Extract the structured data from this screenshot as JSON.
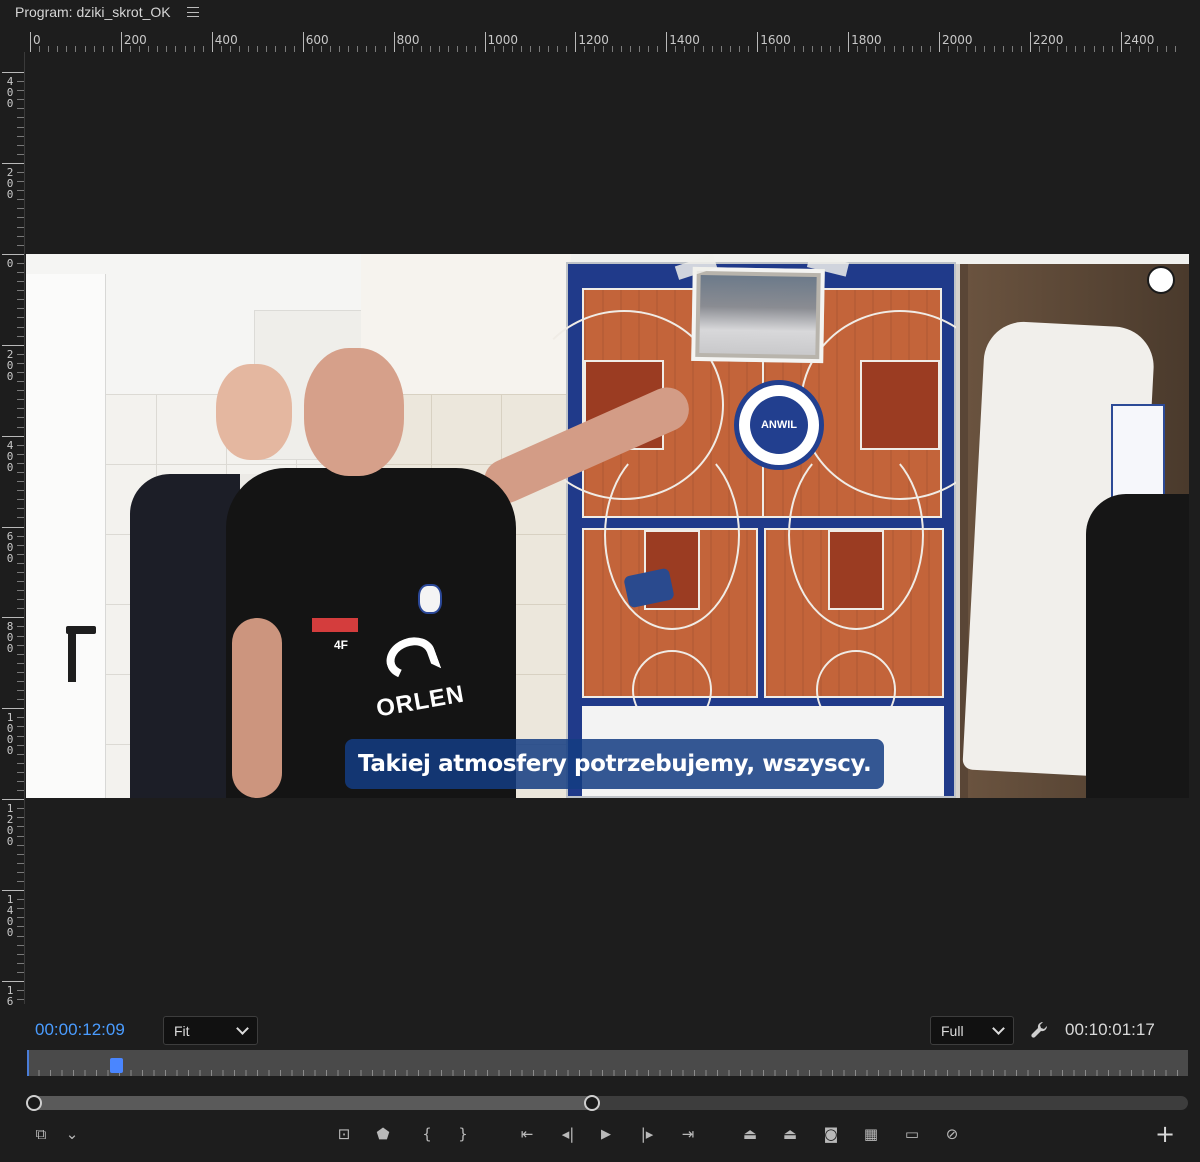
{
  "panel": {
    "title": "Program: dziki_skrot_OK",
    "menu_icon": "hamburger-icon"
  },
  "ruler_h_labels": [
    "0",
    "200",
    "400",
    "600",
    "800",
    "1000",
    "1200",
    "1400",
    "1600",
    "1800",
    "2000",
    "2200",
    "2400"
  ],
  "ruler_v_labels": [
    "4\n0\n0",
    "2\n0\n0",
    "0",
    "2\n0\n0",
    "4\n0\n0",
    "6\n0\n0",
    "8\n0\n0",
    "1\n0\n0\n0",
    "1\n2\n0\n0",
    "1\n4\n0\n0",
    "1\n6"
  ],
  "video": {
    "subtitle": "Takiej atmosfery potrzebujemy, wszyscy.",
    "board_logo_text": "ANWIL",
    "shirt_text": "ORLEN",
    "shirt_badge": "4F"
  },
  "controls": {
    "current_timecode": "00:00:12:09",
    "zoom_select": "Fit",
    "resolution_select": "Full",
    "duration_timecode": "00:10:01:17",
    "accent_color": "#4a9cff"
  },
  "playback_buttons": [
    {
      "name": "export-frame-icon-left",
      "glyph": "⧉"
    },
    {
      "name": "settings-chevron-icon",
      "glyph": "⌄"
    },
    {
      "name": "insert-search-icon",
      "glyph": "⊡"
    },
    {
      "name": "add-marker-icon",
      "glyph": "⬟"
    },
    {
      "name": "mark-in-icon",
      "glyph": "{"
    },
    {
      "name": "mark-out-icon",
      "glyph": "}"
    },
    {
      "name": "go-to-in-icon",
      "glyph": "⇤"
    },
    {
      "name": "step-back-icon",
      "glyph": "◂|"
    },
    {
      "name": "play-icon",
      "glyph": "▶"
    },
    {
      "name": "step-forward-icon",
      "glyph": "|▸"
    },
    {
      "name": "go-to-out-icon",
      "glyph": "⇥"
    },
    {
      "name": "lift-icon",
      "glyph": "⏏"
    },
    {
      "name": "extract-icon",
      "glyph": "⏏"
    },
    {
      "name": "export-frame-icon",
      "glyph": "◙"
    },
    {
      "name": "comparison-view-icon",
      "glyph": "▦"
    },
    {
      "name": "safe-margins-icon",
      "glyph": "▭"
    },
    {
      "name": "proxy-toggle-icon",
      "glyph": "⊘"
    },
    {
      "name": "add-button-icon",
      "glyph": "+"
    }
  ]
}
